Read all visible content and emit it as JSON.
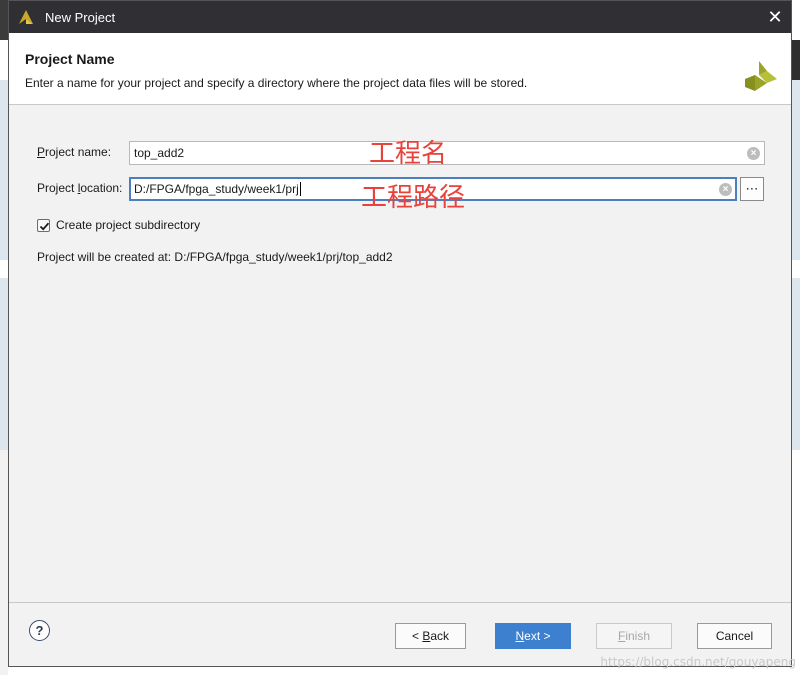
{
  "window": {
    "title": "New Project",
    "close_glyph": "✕"
  },
  "header": {
    "title": "Project Name",
    "description": "Enter a name for your project and specify a directory where the project data files will be stored."
  },
  "form": {
    "name_label_mnemonic": "P",
    "name_label_rest": "roject name:",
    "name_value": "top_add2",
    "location_label_prefix": "Project ",
    "location_label_mnemonic": "l",
    "location_label_rest": "ocation:",
    "location_value": "D:/FPGA/fpga_study/week1/prj",
    "browse_glyph": "⋯",
    "subdirectory_label": "Create project subdirectory",
    "subdirectory_checked": true,
    "created_at_label": "Project will be created at: D:/FPGA/fpga_study/week1/prj/top_add2"
  },
  "annotations": {
    "name_note": "工程名",
    "location_note": "工程路径"
  },
  "footer": {
    "help_glyph": "?",
    "back_prefix": "< ",
    "back_mnemonic": "B",
    "back_rest": "ack",
    "next_mnemonic": "N",
    "next_rest": "ext >",
    "finish_mnemonic": "F",
    "finish_rest": "inish",
    "cancel_label": "Cancel"
  },
  "watermark": "https://blog.csdn.net/gouyapeng",
  "icons": {
    "app": "vivado-logo-icon",
    "header_logo": "xilinx-logo-icon",
    "help": "help-icon",
    "clear": "clear-icon",
    "checkbox": "check-icon"
  },
  "colors": {
    "titlebar": "#2f2f34",
    "primary_button": "#3e80d0",
    "annotation": "#e8423a",
    "logo_green": "#9aa428"
  }
}
